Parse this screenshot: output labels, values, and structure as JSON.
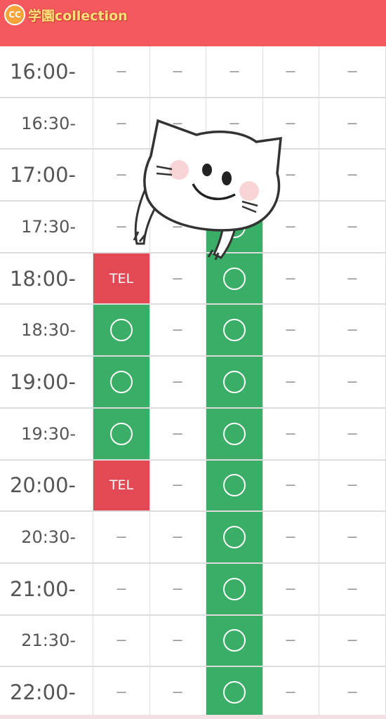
{
  "header": {
    "brand_badge": "CC",
    "brand_text": "学園collection",
    "color": "#f4595d"
  },
  "legend": {
    "available": "○",
    "phone": "TEL",
    "unavailable": "－"
  },
  "colors": {
    "available": "#3aae66",
    "phone": "#e34855"
  },
  "schedule": [
    {
      "time": "16:00-",
      "cells": [
        "－",
        "－",
        "－",
        "－",
        "－"
      ]
    },
    {
      "time": "16:30-",
      "cells": [
        "－",
        "－",
        "－",
        "－",
        "－"
      ]
    },
    {
      "time": "17:00-",
      "cells": [
        "－",
        "－",
        "－",
        "－",
        "－"
      ]
    },
    {
      "time": "17:30-",
      "cells": [
        "－",
        "－",
        "○",
        "－",
        "－"
      ]
    },
    {
      "time": "18:00-",
      "cells": [
        "TEL",
        "－",
        "○",
        "－",
        "－"
      ]
    },
    {
      "time": "18:30-",
      "cells": [
        "○",
        "－",
        "○",
        "－",
        "－"
      ]
    },
    {
      "time": "19:00-",
      "cells": [
        "○",
        "－",
        "○",
        "－",
        "－"
      ]
    },
    {
      "time": "19:30-",
      "cells": [
        "○",
        "－",
        "○",
        "－",
        "－"
      ]
    },
    {
      "time": "20:00-",
      "cells": [
        "TEL",
        "－",
        "○",
        "－",
        "－"
      ]
    },
    {
      "time": "20:30-",
      "cells": [
        "－",
        "－",
        "○",
        "－",
        "－"
      ]
    },
    {
      "time": "21:00-",
      "cells": [
        "－",
        "－",
        "○",
        "－",
        "－"
      ]
    },
    {
      "time": "21:30-",
      "cells": [
        "－",
        "－",
        "○",
        "－",
        "－"
      ]
    },
    {
      "time": "22:00-",
      "cells": [
        "－",
        "－",
        "○",
        "－",
        "－"
      ]
    }
  ]
}
